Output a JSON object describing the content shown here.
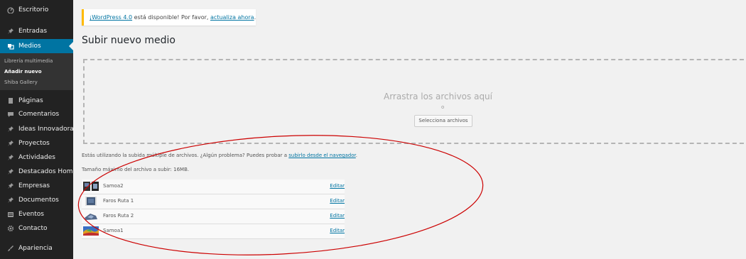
{
  "sidebar": {
    "items": [
      {
        "label": "Escritorio",
        "icon": "dashboard-icon"
      },
      {
        "label": "Entradas",
        "icon": "pin-icon"
      },
      {
        "label": "Medios",
        "icon": "media-icon"
      },
      {
        "label": "Páginas",
        "icon": "pages-icon"
      },
      {
        "label": "Comentarios",
        "icon": "comments-icon"
      },
      {
        "label": "Ideas Innovadoras",
        "icon": "pin-icon"
      },
      {
        "label": "Proyectos",
        "icon": "pin-icon"
      },
      {
        "label": "Actividades",
        "icon": "pin-icon"
      },
      {
        "label": "Destacados Home",
        "icon": "pin-icon"
      },
      {
        "label": "Empresas",
        "icon": "pin-icon"
      },
      {
        "label": "Documentos",
        "icon": "pin-icon"
      },
      {
        "label": "Eventos",
        "icon": "calendar-icon"
      },
      {
        "label": "Contacto",
        "icon": "gear-icon"
      },
      {
        "label": "Apariencia",
        "icon": "brush-icon"
      }
    ],
    "submenu": [
      "Librería multimedia",
      "Añadir nuevo",
      "Shiba Gallery"
    ]
  },
  "notice": {
    "link1": "¡WordPress 4.0",
    "text1": " está disponible! Por favor, ",
    "link2": "actualiza ahora",
    "text2": "."
  },
  "page_title": "Subir nuevo medio",
  "dropzone": {
    "text": "Arrastra los archivos aquí",
    "or": "o",
    "button": "Selecciona archivos"
  },
  "uploader": {
    "multi_text": "Estás utilizando la subida múltiple de archivos. ¿Algún problema? Puedes probar a ",
    "multi_link": "subirlo desde el navegador",
    "multi_end": ".",
    "max_size": "Tamaño máximo del archivo a subir: 16MB."
  },
  "media": [
    {
      "name": "Samoa2",
      "edit": "Editar"
    },
    {
      "name": "Faros Ruta 1",
      "edit": "Editar"
    },
    {
      "name": "Faros Ruta 2",
      "edit": "Editar"
    },
    {
      "name": "Samoa1",
      "edit": "Editar"
    }
  ],
  "colors": {
    "sidebar_bg": "#222222",
    "active": "#0074a2",
    "annotation": "#cc0000",
    "notice_border": "#ffba00"
  }
}
